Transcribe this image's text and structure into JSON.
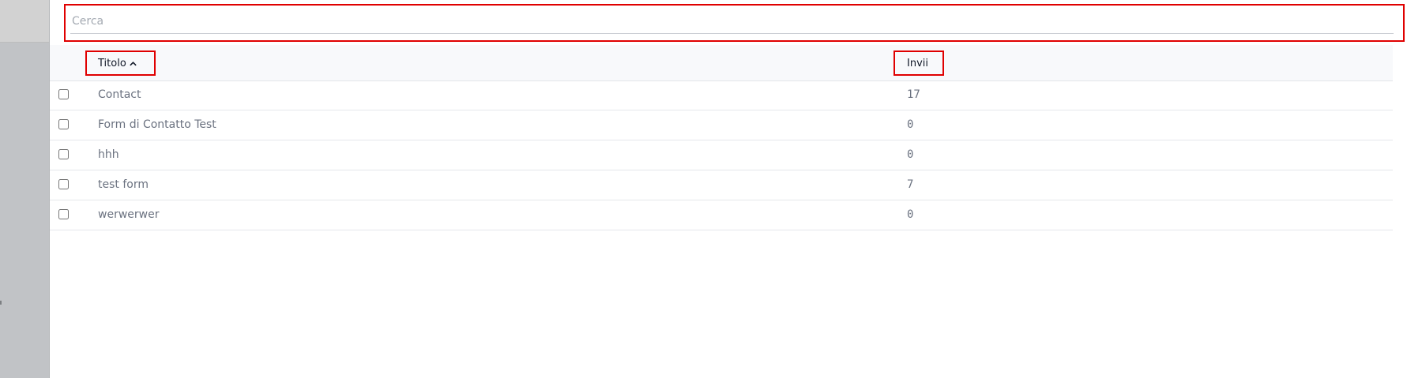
{
  "search": {
    "placeholder": "Cerca",
    "value": ""
  },
  "table": {
    "columns": [
      {
        "label": "Titolo",
        "sort": "ascending",
        "sort_icon": "chevron-up-icon"
      },
      {
        "label": "Invii"
      }
    ],
    "rows": [
      {
        "title": "Contact",
        "sends": "17",
        "checked": false
      },
      {
        "title": "Form di Contatto Test",
        "sends": "0",
        "checked": false
      },
      {
        "title": "hhh",
        "sends": "0",
        "checked": false
      },
      {
        "title": "test form",
        "sends": "7",
        "checked": false
      },
      {
        "title": "werwerwer",
        "sends": "0",
        "checked": false
      }
    ]
  },
  "colors": {
    "highlight": "#e00000",
    "sidebar": "#c1c3c6",
    "header_bg": "#f8f9fb",
    "muted_text": "#6b7280"
  }
}
